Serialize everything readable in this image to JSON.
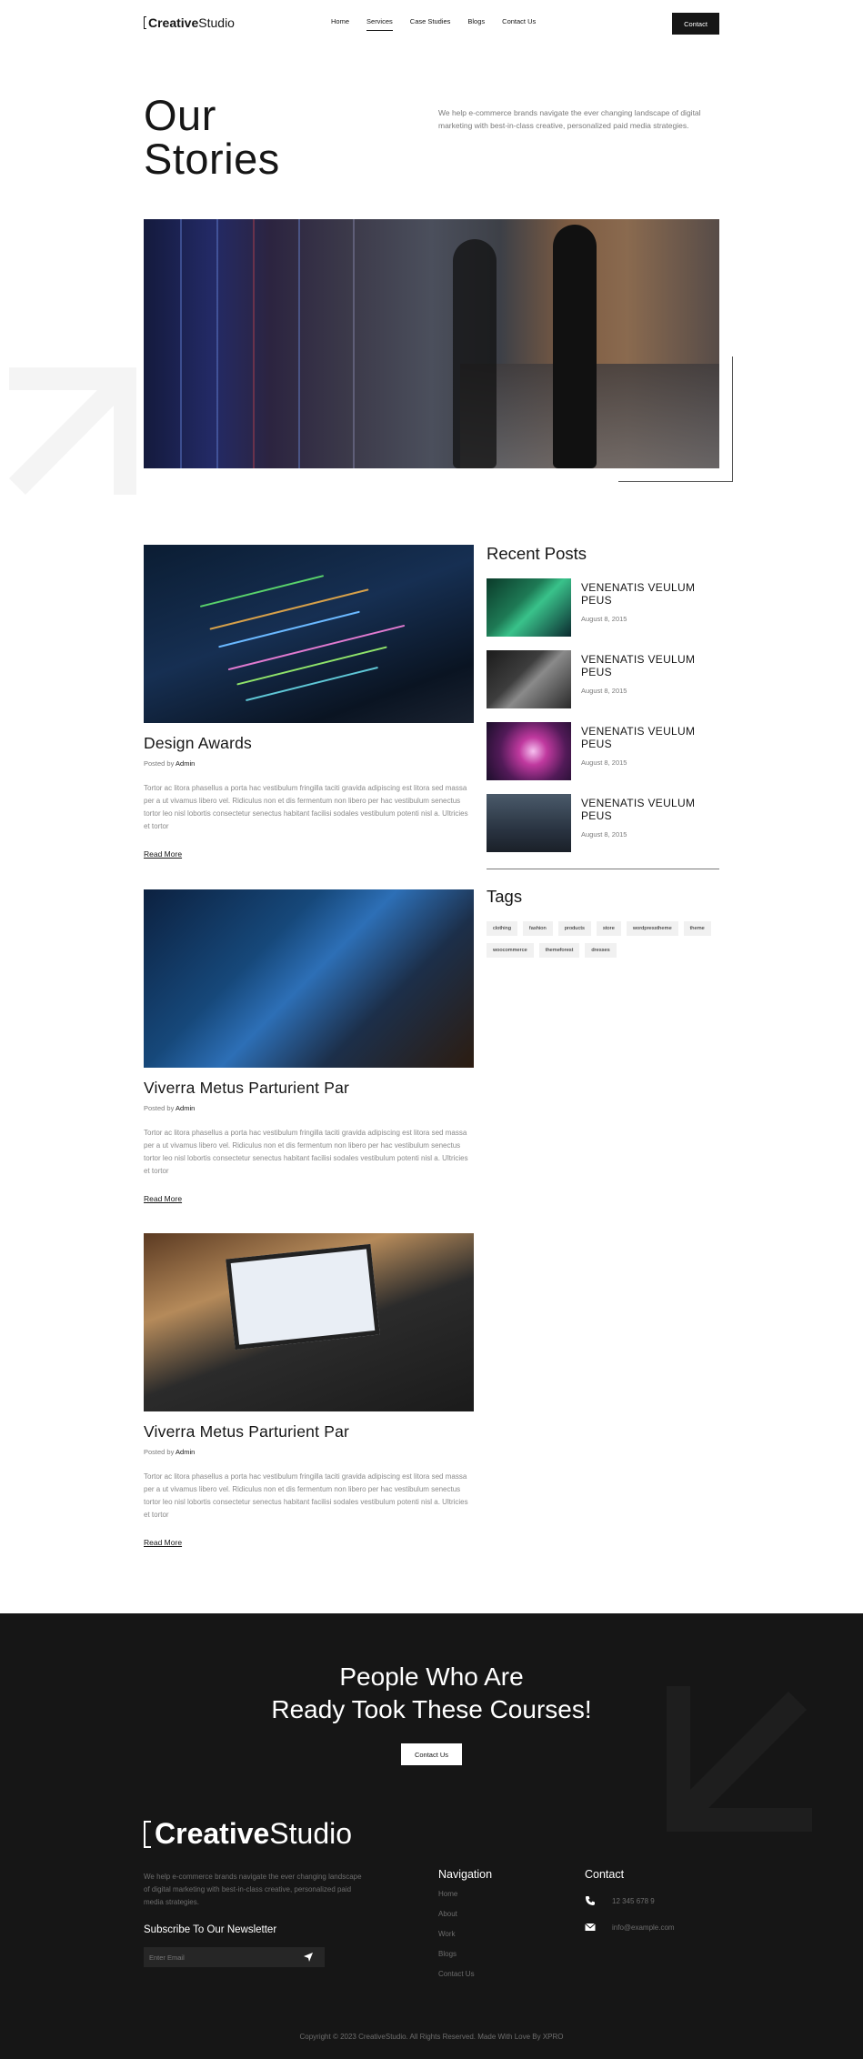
{
  "header": {
    "logo_bold": "Creative",
    "logo_light": "Studio",
    "nav": [
      {
        "label": "Home",
        "active": false
      },
      {
        "label": "Services",
        "active": true
      },
      {
        "label": "Case Studies",
        "active": false
      },
      {
        "label": "Blogs",
        "active": false
      },
      {
        "label": "Contact Us",
        "active": false
      }
    ],
    "contact_label": "Contact"
  },
  "hero": {
    "title_line1": "Our",
    "title_line2": "Stories",
    "description": "We help e-commerce brands navigate the ever changing landscape of digital marketing with best-in-class creative, personalized paid media strategies."
  },
  "posts": [
    {
      "title": "Design Awards",
      "posted_by": "Posted by",
      "author": "Admin",
      "excerpt": "Tortor ac litora phasellus a porta hac vestibulum fringilla taciti gravida adipiscing est litora sed massa per a ut vivamus libero vel. Ridiculus non et dis fermentum non libero per hac vestibulum senectus tortor leo nisl lobortis consectetur senectus habitant facilisi sodales vestibulum potenti nisl a. Ultricies et tortor",
      "read_more": "Read More"
    },
    {
      "title": "Viverra Metus Parturient Par",
      "posted_by": "Posted by",
      "author": "Admin",
      "excerpt": "Tortor ac litora phasellus a porta hac vestibulum fringilla taciti gravida adipiscing est litora sed massa per a ut vivamus libero vel. Ridiculus non et dis fermentum non libero per hac vestibulum senectus tortor leo nisl lobortis consectetur senectus habitant facilisi sodales vestibulum potenti nisl a. Ultricies et tortor",
      "read_more": "Read More"
    },
    {
      "title": "Viverra Metus Parturient Par",
      "posted_by": "Posted by",
      "author": "Admin",
      "excerpt": "Tortor ac litora phasellus a porta hac vestibulum fringilla taciti gravida adipiscing est litora sed massa per a ut vivamus libero vel. Ridiculus non et dis fermentum non libero per hac vestibulum senectus tortor leo nisl lobortis consectetur senectus habitant facilisi sodales vestibulum potenti nisl a. Ultricies et tortor",
      "read_more": "Read More"
    }
  ],
  "sidebar": {
    "recent_title": "Recent Posts",
    "recent": [
      {
        "title": "VENENATIS VEULUM PEUS",
        "date": "August 8, 2015"
      },
      {
        "title": "VENENATIS VEULUM PEUS",
        "date": "August 8, 2015"
      },
      {
        "title": "VENENATIS VEULUM PEUS",
        "date": "August 8, 2015"
      },
      {
        "title": "VENENATIS VEULUM PEUS",
        "date": "August 8, 2015"
      }
    ],
    "tags_title": "Tags",
    "tags": [
      "clothing",
      "fashion",
      "products",
      "store",
      "wordpresstheme",
      "theme",
      "woocommerce",
      "themeforest",
      "dresses"
    ]
  },
  "cta": {
    "line1": "People Who Are",
    "line2": "Ready Took These Courses!",
    "button": "Contact Us"
  },
  "footer": {
    "logo_bold": "Creative",
    "logo_light": "Studio",
    "description": "We help e-commerce brands navigate the ever changing landscape of digital marketing with best-in-class creative, personalized paid media strategies.",
    "subscribe_title": "Subscribe To Our Newsletter",
    "email_placeholder": "Enter Email",
    "nav_title": "Navigation",
    "nav": [
      "Home",
      "About",
      "Work",
      "Blogs",
      "Contact Us"
    ],
    "contact_title": "Contact",
    "phone": "12 345 678 9",
    "email": "info@example.com",
    "copyright": "Copyright © 2023 CreativeStudio. All Rights Reserved. Made With Love By XPRO"
  }
}
